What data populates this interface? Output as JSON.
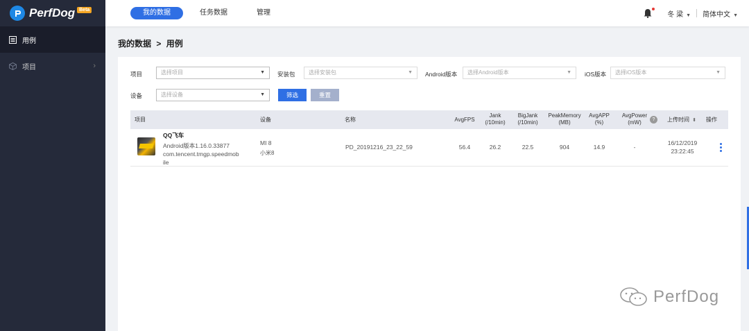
{
  "brand": {
    "name": "PerfDog",
    "badge": "Beta"
  },
  "sidebar": {
    "items": [
      {
        "label": "用例",
        "active": true
      },
      {
        "label": "项目",
        "active": false
      }
    ]
  },
  "topnav": {
    "tabs": [
      {
        "label": "我的数据",
        "active": true
      },
      {
        "label": "任务数据",
        "active": false
      },
      {
        "label": "管理",
        "active": false
      }
    ],
    "user": "冬 梁",
    "language": "简体中文"
  },
  "breadcrumb": {
    "parent": "我的数据",
    "separator": ">",
    "current": "用例"
  },
  "filters": {
    "project": {
      "label": "项目",
      "placeholder": "选择项目"
    },
    "package": {
      "label": "安装包",
      "placeholder": "选择安装包"
    },
    "android": {
      "label": "Android版本",
      "placeholder": "选择Android版本"
    },
    "ios": {
      "label": "iOS版本",
      "placeholder": "选择iOS版本"
    },
    "device": {
      "label": "设备",
      "placeholder": "选择设备"
    },
    "filter_button": "筛选",
    "reset_button": "重置"
  },
  "table": {
    "headers": {
      "project": "项目",
      "device": "设备",
      "name": "名称",
      "avgfps": "AvgFPS",
      "jank": [
        "Jank",
        "(/10min)"
      ],
      "bigjank": [
        "BigJank",
        "(/10min)"
      ],
      "peakmemory": [
        "PeakMemory",
        "(MB)"
      ],
      "avgapp": [
        "AvgAPP",
        "(%)"
      ],
      "avgpower": [
        "AvgPower",
        "(mW)"
      ],
      "upload_time": "上传时间",
      "actions": "操作"
    },
    "rows": [
      {
        "app_name": "QQ飞车",
        "version": "Android版本1.16.0.33877",
        "package_line1": "com.tencent.tmgp.speedmob",
        "package_line2": "ile",
        "device_model": "MI 8",
        "device_name": "小米8",
        "name": "PD_20191216_23_22_59",
        "avgfps": "56.4",
        "jank": "26.2",
        "bigjank": "22.5",
        "peakmemory": "904",
        "avgapp": "14.9",
        "avgpower": "-",
        "upload_date": "16/12/2019",
        "upload_time": "23:22:45"
      }
    ]
  },
  "watermark": "PerfDog",
  "colors": {
    "primary": "#2f6fe4",
    "sidebar": "#252a3a",
    "badge": "#f5a623"
  }
}
